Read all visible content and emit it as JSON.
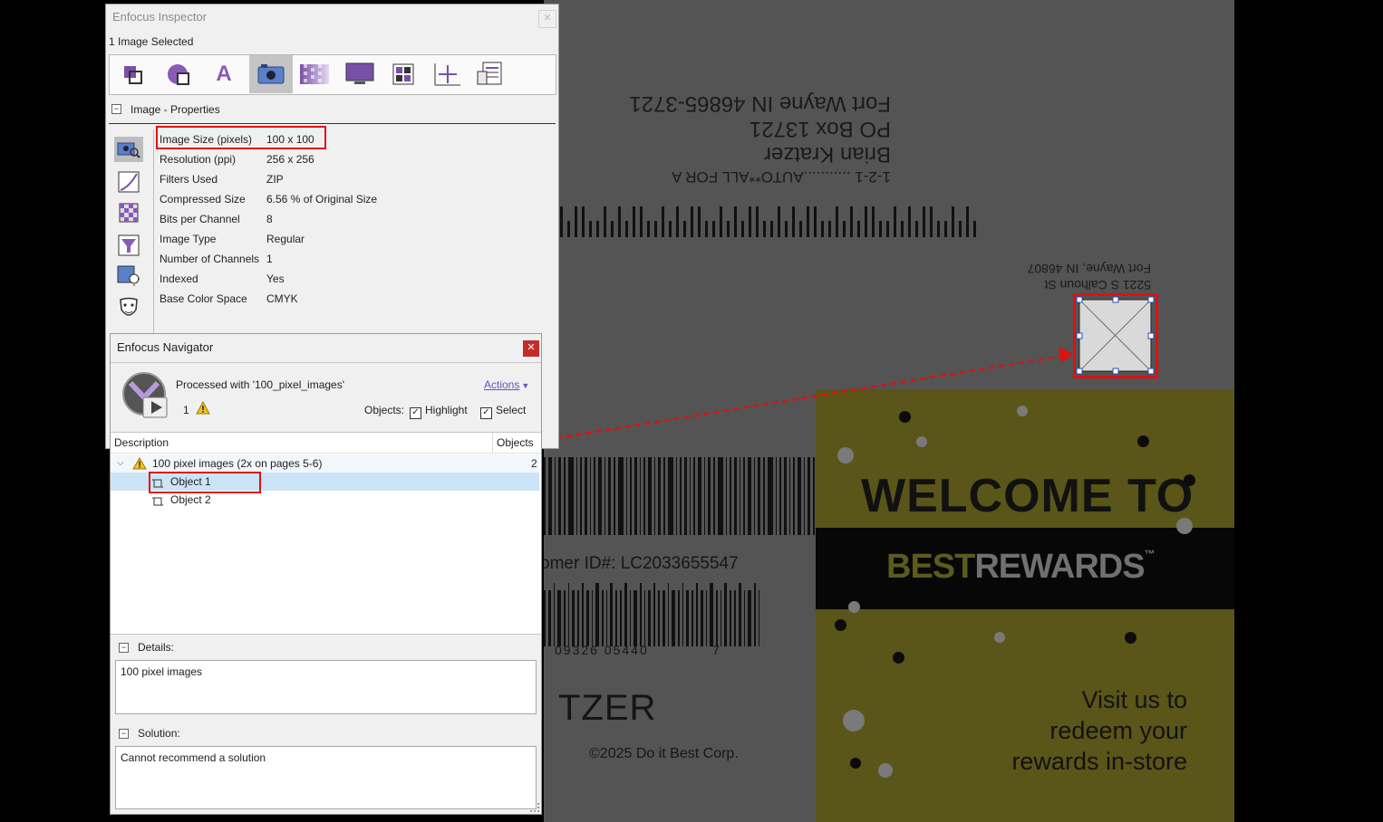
{
  "inspector": {
    "title": "Enfocus Inspector",
    "selection_status": "1 Image Selected",
    "toolbar_icons": [
      "object-icon",
      "shape-icon",
      "text-icon",
      "image-icon",
      "transparency-icon",
      "display-icon",
      "layout-icon",
      "position-icon",
      "document-info-icon"
    ],
    "section_title": "Image - Properties",
    "side_icons": [
      "image-properties-icon",
      "curves-icon",
      "checker-icon",
      "filter-icon",
      "color-adjust-icon",
      "mask-face-icon"
    ],
    "properties": [
      {
        "label": "Image Size (pixels)",
        "value": "100 x 100"
      },
      {
        "label": "Resolution (ppi)",
        "value": "256 x 256"
      },
      {
        "label": "Filters Used",
        "value": "ZIP"
      },
      {
        "label": "Compressed Size",
        "value": "6.56 % of Original Size"
      },
      {
        "label": "Bits per Channel",
        "value": "8"
      },
      {
        "label": "Image Type",
        "value": "Regular"
      },
      {
        "label": "Number of Channels",
        "value": "1"
      },
      {
        "label": "Indexed",
        "value": "Yes"
      },
      {
        "label": "Base Color Space",
        "value": "CMYK"
      }
    ]
  },
  "navigator": {
    "title": "Enfocus Navigator",
    "processed_with": "Processed with '100_pixel_images'",
    "actions_label": "Actions",
    "warning_count": "1",
    "objects_label": "Objects:",
    "highlight_label": "Highlight",
    "select_label": "Select",
    "col_description": "Description",
    "col_objects": "Objects",
    "tree_group": {
      "label": "100 pixel images (2x on pages 5-6)",
      "count": "2"
    },
    "tree_items": [
      "Object 1",
      "Object 2"
    ],
    "details_label": "Details:",
    "details_text": "100 pixel images",
    "solution_label": "Solution:",
    "solution_text": "Cannot recommend a solution"
  },
  "document": {
    "return_address": [
      "Fort Wayne IN  46865-3721",
      "PO Box 13721",
      "Brian Kratzer",
      "1-2-1 ...........AUTO**ALL FOR A"
    ],
    "mail_address": [
      "5221 S Calhoun St",
      "Fort Wayne, IN 46807"
    ],
    "customer_id": "omer ID#: LC2033655547",
    "upc_digits": "09326 05440",
    "upc_check": "7",
    "name_fragment": "TZER",
    "copyright": "©2025 Do it Best Corp.",
    "welcome": "WELCOME TO",
    "brand_best": "BEST",
    "brand_rewards": "REWARDS",
    "tm": "™",
    "promo_lines": [
      "Visit us to",
      "redeem your",
      "rewards in-store"
    ]
  },
  "colors": {
    "highlight_red": "#e01010",
    "promo_olive": "#5a5518",
    "canvas_gray": "#545454",
    "selection_blue": "#cce4f7",
    "link_purple": "#6b4fc4"
  }
}
